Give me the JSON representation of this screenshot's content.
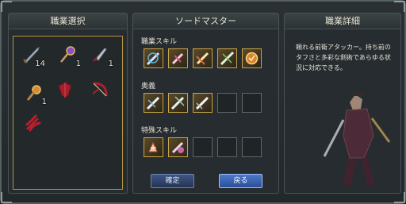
{
  "left_panel": {
    "title": "職業選択",
    "items": [
      {
        "icon": "sword-icon",
        "count": "14"
      },
      {
        "icon": "staff-icon",
        "count": "1"
      },
      {
        "icon": "dagger-icon",
        "count": "1"
      },
      {
        "icon": "mace-icon",
        "count": "1"
      },
      {
        "icon": "shield-icon",
        "count": ""
      },
      {
        "icon": "bow-icon",
        "count": ""
      },
      {
        "icon": "claw-icon",
        "count": ""
      }
    ]
  },
  "middle_panel": {
    "title": "ソードマスター",
    "sections": {
      "job_skills": "職業スキル",
      "ultimate": "奥義",
      "special_skills": "特殊スキル"
    },
    "buttons": {
      "confirm": "確定",
      "back": "戻る"
    }
  },
  "right_panel": {
    "title": "職業詳細",
    "description": "頼れる前衛アタッカー。持ち前のタフさと多彩な剣術であらゆる状況に対応できる。"
  },
  "colors": {
    "gold_border": "#b7963c",
    "button_blue": "#2b4f98",
    "panel_bg": "#262c2f"
  }
}
